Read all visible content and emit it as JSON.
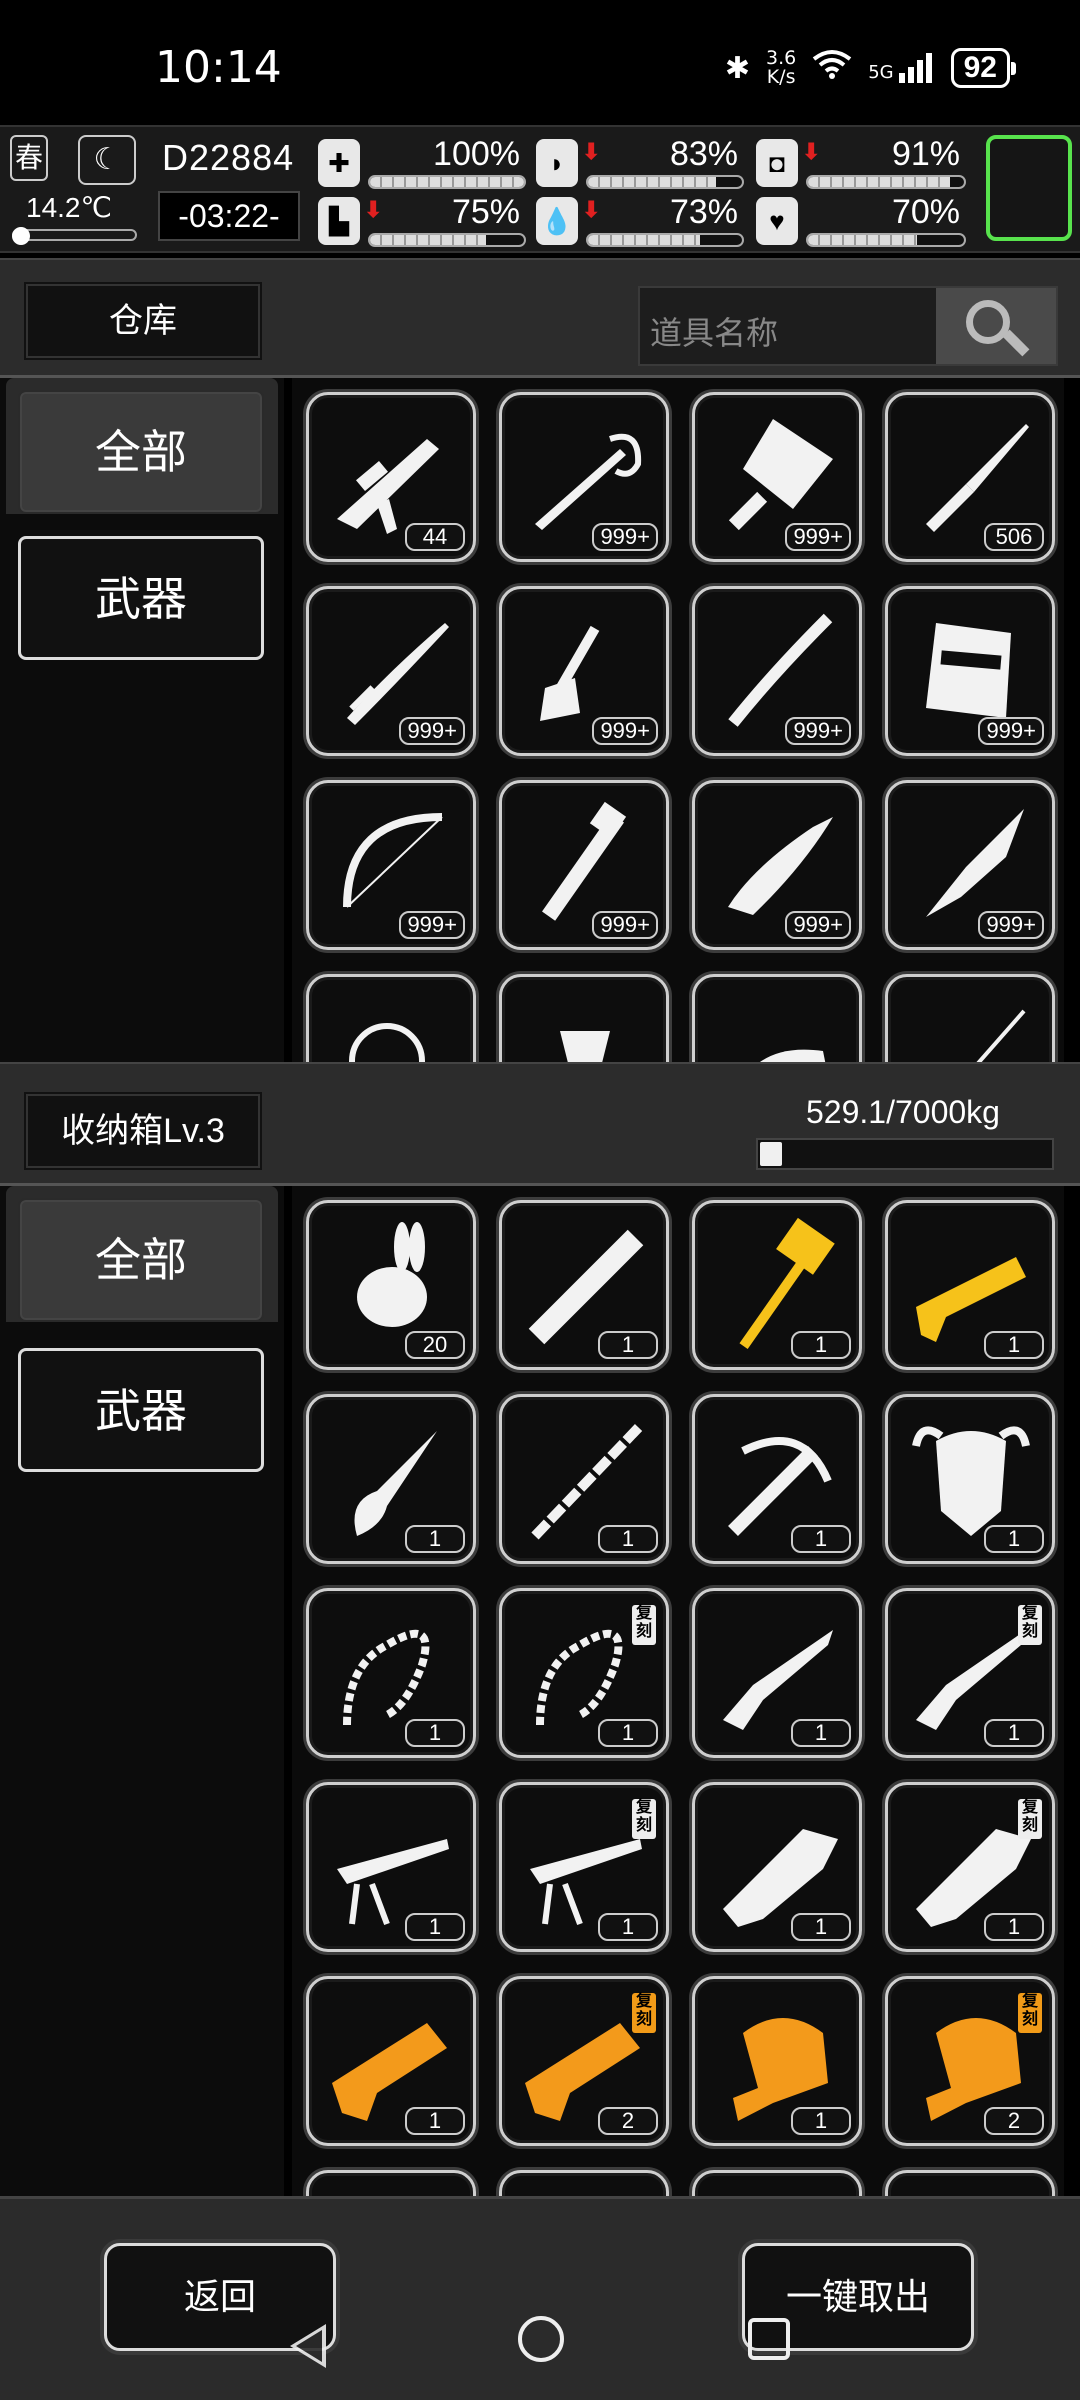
{
  "status_bar": {
    "time": "10:14",
    "net_speed_value": "3.6",
    "net_speed_unit": "K/s",
    "network": "5G",
    "battery": "92",
    "icons": [
      "bluetooth-icon",
      "wifi-icon",
      "signal-icon",
      "battery-icon"
    ]
  },
  "hud": {
    "season": "春",
    "temperature": "14.2℃",
    "day": "D22884",
    "clock": "-03:22-",
    "stats": [
      {
        "name": "health",
        "icon": "medkit-icon",
        "value": "100%",
        "level": 1.0,
        "down": false
      },
      {
        "name": "hunger",
        "icon": "stomach-icon",
        "value": "83%",
        "level": 0.83,
        "down": true
      },
      {
        "name": "bladder",
        "icon": "toilet-icon",
        "value": "91%",
        "level": 0.91,
        "down": true
      },
      {
        "name": "stamina",
        "icon": "boot-icon",
        "value": "75%",
        "level": 0.75,
        "down": true
      },
      {
        "name": "thirst",
        "icon": "water-drop-icon",
        "value": "73%",
        "level": 0.73,
        "down": true
      },
      {
        "name": "mood",
        "icon": "heart-icon",
        "value": "70%",
        "level": 0.7,
        "down": false
      }
    ],
    "accent_green": "#58e34d"
  },
  "warehouse": {
    "title": "仓库",
    "search_placeholder": "道具名称",
    "categories": [
      {
        "label": "全部",
        "active": true
      },
      {
        "label": "武器",
        "active": false
      }
    ],
    "items": [
      {
        "icon": "assault-rifle-icon",
        "count": "44",
        "color": "white"
      },
      {
        "icon": "rapier-icon",
        "count": "999+",
        "color": "white"
      },
      {
        "icon": "cleaver-icon",
        "count": "999+",
        "color": "white"
      },
      {
        "icon": "awl-icon",
        "count": "506",
        "color": "white"
      },
      {
        "icon": "katana-icon",
        "count": "999+",
        "color": "white"
      },
      {
        "icon": "shovel-icon",
        "count": "999+",
        "color": "white"
      },
      {
        "icon": "stick-icon",
        "count": "999+",
        "color": "white"
      },
      {
        "icon": "riot-shield-icon",
        "count": "999+",
        "color": "white"
      },
      {
        "icon": "bow-icon",
        "count": "999+",
        "color": "white"
      },
      {
        "icon": "pipe-wrench-icon",
        "count": "999+",
        "color": "white"
      },
      {
        "icon": "folding-knife-icon",
        "count": "999+",
        "color": "white"
      },
      {
        "icon": "crude-blade-icon",
        "count": "999+",
        "color": "white"
      },
      {
        "icon": "whip-icon",
        "count": "",
        "color": "white"
      },
      {
        "icon": "axe-icon",
        "count": "",
        "color": "white"
      },
      {
        "icon": "iron-icon",
        "count": "",
        "color": "white"
      },
      {
        "icon": "needle-icon",
        "count": "",
        "color": "white"
      }
    ]
  },
  "storage": {
    "title": "收纳箱Lv.3",
    "weight": "529.1/7000kg",
    "weight_fraction": 0.0756,
    "categories": [
      {
        "label": "全部",
        "active": true
      },
      {
        "label": "武器",
        "active": false
      }
    ],
    "dup_tag": "复刻",
    "items": [
      {
        "icon": "rabbit-mount-icon",
        "count": "20",
        "color": "white",
        "dup": false
      },
      {
        "icon": "rocket-launcher-icon",
        "count": "1",
        "color": "white",
        "dup": false
      },
      {
        "icon": "golden-hammer-icon",
        "count": "1",
        "color": "gold",
        "dup": false
      },
      {
        "icon": "golden-shotgun-icon",
        "count": "1",
        "color": "gold",
        "dup": false
      },
      {
        "icon": "feather-dagger-icon",
        "count": "1",
        "color": "white",
        "dup": false
      },
      {
        "icon": "bamboo-staff-icon",
        "count": "1",
        "color": "white",
        "dup": false
      },
      {
        "icon": "crossbow-icon",
        "count": "1",
        "color": "white",
        "dup": false
      },
      {
        "icon": "bull-mask-icon",
        "count": "1",
        "color": "white",
        "dup": false
      },
      {
        "icon": "chain-whip-icon",
        "count": "1",
        "color": "white",
        "dup": false
      },
      {
        "icon": "chain-whip-icon",
        "count": "1",
        "color": "white",
        "dup": true
      },
      {
        "icon": "dragon-rifle-icon",
        "count": "1",
        "color": "white",
        "dup": false
      },
      {
        "icon": "dragon-rifle-icon",
        "count": "1",
        "color": "white",
        "dup": true
      },
      {
        "icon": "sniper-rifle-icon",
        "count": "1",
        "color": "white",
        "dup": false
      },
      {
        "icon": "sniper-rifle-icon",
        "count": "1",
        "color": "white",
        "dup": true
      },
      {
        "icon": "dragon-cannon-icon",
        "count": "1",
        "color": "white",
        "dup": false
      },
      {
        "icon": "dragon-cannon-icon",
        "count": "1",
        "color": "white",
        "dup": true
      },
      {
        "icon": "golden-smg-icon",
        "count": "1",
        "color": "orange",
        "dup": false
      },
      {
        "icon": "golden-smg-icon",
        "count": "2",
        "color": "orange",
        "dup": true
      },
      {
        "icon": "golden-launcher-icon",
        "count": "1",
        "color": "orange",
        "dup": false
      },
      {
        "icon": "golden-launcher-icon",
        "count": "2",
        "color": "orange",
        "dup": true
      },
      {
        "icon": "item-icon",
        "count": "",
        "color": "white",
        "dup": false
      },
      {
        "icon": "item-icon",
        "count": "",
        "color": "white",
        "dup": false
      },
      {
        "icon": "item-icon",
        "count": "",
        "color": "white",
        "dup": false
      },
      {
        "icon": "item-icon",
        "count": "",
        "color": "white",
        "dup": false
      }
    ]
  },
  "buttons": {
    "back": "返回",
    "take_all": "一键取出"
  },
  "colors": {
    "white": "#f2f2f2",
    "gold": "#f6c21a",
    "orange": "#f39a1b"
  }
}
